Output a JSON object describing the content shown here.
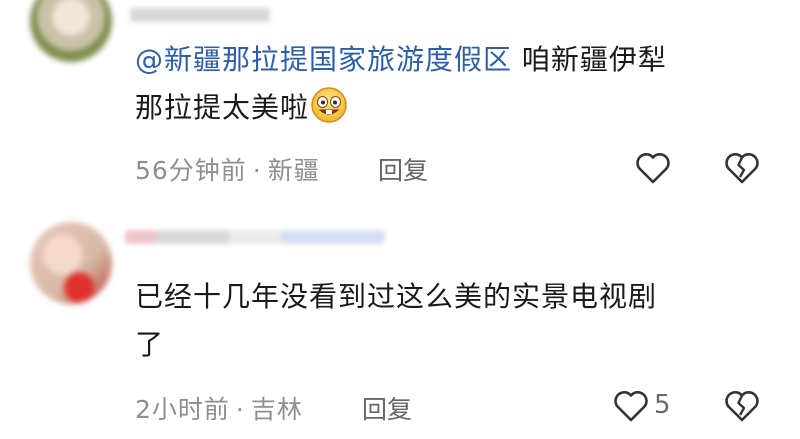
{
  "comments": [
    {
      "mention": "@新疆那拉提国家旅游度假区",
      "text_line1_rest": "咱新疆伊犁",
      "text_line2": "那拉提太美啦",
      "emoji_icon": "grinning-face-emoji",
      "time": "56分钟前",
      "location": "新疆",
      "reply_label": "回复"
    },
    {
      "text_line1": "已经十几年没看到过这么美的实景电视剧",
      "text_line2": "了",
      "time": "2小时前",
      "location": "吉林",
      "reply_label": "回复",
      "likes": "5"
    }
  ],
  "separator": "·",
  "colors": {
    "mention": "#2f5ea8",
    "text": "#1a1a1a",
    "meta": "#8f8f8f"
  }
}
